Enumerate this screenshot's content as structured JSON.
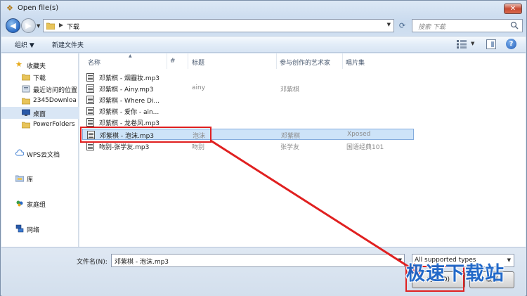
{
  "window": {
    "title": "Open file(s)",
    "close_label": "✕"
  },
  "nav": {
    "back_label": "◀",
    "forward_label": "▶",
    "breadcrumb_sep": "▶",
    "path": "下载",
    "refresh_label": "⟳",
    "search_placeholder": "搜索 下载"
  },
  "toolbar": {
    "organize_label": "组织 ▼",
    "new_folder_label": "新建文件夹"
  },
  "sidebar": {
    "items": [
      {
        "label": "收藏夹",
        "icon": "star-icon"
      },
      {
        "label": "下载",
        "icon": "folder-icon"
      },
      {
        "label": "最近访问的位置",
        "icon": "recent-icon"
      },
      {
        "label": "2345Downloa",
        "icon": "folder-icon"
      },
      {
        "label": "桌面",
        "icon": "desktop-icon"
      },
      {
        "label": "PowerFolders",
        "icon": "folder-icon"
      },
      {
        "label": "WPS云文档",
        "icon": "cloud-icon"
      },
      {
        "label": "库",
        "icon": "library-icon"
      },
      {
        "label": "家庭组",
        "icon": "homegroup-icon"
      },
      {
        "label": "网络",
        "icon": "network-icon"
      }
    ]
  },
  "columns": {
    "name": "名称",
    "number": "#",
    "title": "标题",
    "artist": "参与创作的艺术家",
    "album": "唱片集"
  },
  "files": [
    {
      "name": "邓紫棋 - 烟霾妆.mp3",
      "title": "",
      "artist": "",
      "album": ""
    },
    {
      "name": "邓紫棋 - Ainy.mp3",
      "title": "ainy",
      "artist": "邓紫棋",
      "album": ""
    },
    {
      "name": "邓紫棋 - Where Di...",
      "title": "",
      "artist": "",
      "album": ""
    },
    {
      "name": "邓紫棋 - 爱你 - ain...",
      "title": "",
      "artist": "",
      "album": ""
    },
    {
      "name": "邓紫棋 - 龙卷风.mp3",
      "title": "",
      "artist": "",
      "album": ""
    },
    {
      "name": "邓紫棋 - 泡沫.mp3",
      "title": "泡沫",
      "artist": "邓紫棋",
      "album": "Xposed",
      "selected": true
    },
    {
      "name": "吻别-张学友.mp3",
      "title": "吻别",
      "artist": "张学友",
      "album": "国语经典101"
    }
  ],
  "bottom": {
    "filename_label": "文件名(N):",
    "filename_value": "邓紫棋 - 泡沫.mp3",
    "filetype_value": "All supported types",
    "open_label": "打开(O)",
    "cancel_label": "取消"
  },
  "watermark": "极速下载站",
  "colors": {
    "annotation": "#e02020",
    "selection": "#cde3f8",
    "watermark": "#1a64c8"
  }
}
